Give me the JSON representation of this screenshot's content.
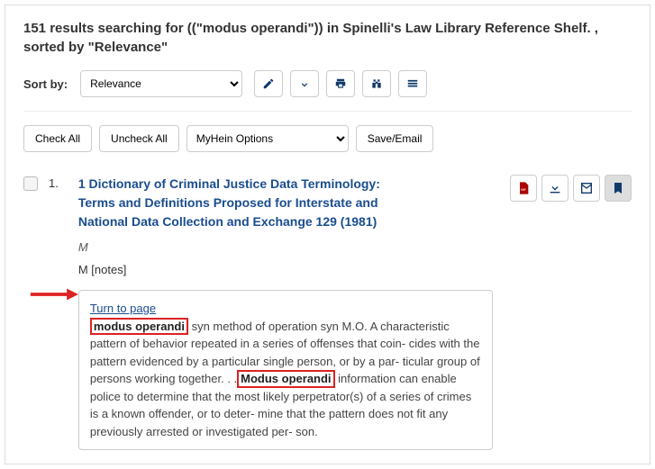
{
  "header": {
    "count": "151",
    "prefix": "results searching for ((\"",
    "term": "modus operandi",
    "suffix": "\")) in Spinelli's Law Library Reference Shelf. , sorted by \"Relevance\""
  },
  "sort": {
    "label": "Sort by:",
    "selected": "Relevance"
  },
  "toolbar": {
    "check_all": "Check All",
    "uncheck_all": "Uncheck All",
    "options": "MyHein Options",
    "save_email": "Save/Email"
  },
  "result": {
    "num": "1.",
    "title": "1 Dictionary of Criminal Justice Data Terminology: Terms and Definitions Proposed for Interstate and National Data Collection and Exchange 129 (1981)",
    "subtitle": "M",
    "notes": "M [notes]",
    "turn_link": "Turn to page",
    "hl1": "modus operandi",
    "snippet_mid1": " syn method of operation syn M.O. A characteristic pattern of behavior repeated in a series of offenses that coin- cides with the pattern evidenced by a particular single person, or by a par- ticular group of persons working together. . .",
    "hl2": "Modus operandi",
    "snippet_mid2": " information can enable police to determine that the most likely perpetrator(s) of a series of crimes is a known offender, or to deter- mine that the pattern does not fit any previously arrested or investigated per- son."
  }
}
